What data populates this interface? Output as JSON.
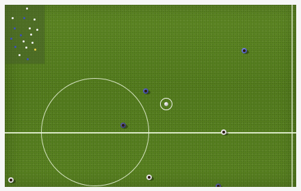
{
  "scene": {
    "type": "top-down football match",
    "pitch_color": "#58811f",
    "line_color": "#ebf5dc"
  },
  "minimap": {
    "background": "#465f28",
    "dots": [
      {
        "team": "white"
      },
      {
        "team": "white"
      },
      {
        "team": "blue"
      },
      {
        "team": "white"
      },
      {
        "team": "blue"
      },
      {
        "team": "white"
      },
      {
        "team": "white"
      },
      {
        "team": "blue"
      },
      {
        "team": "white"
      },
      {
        "team": "blue"
      },
      {
        "team": "white"
      },
      {
        "team": "white"
      },
      {
        "team": "blue"
      },
      {
        "team": "white"
      },
      {
        "team": "yellow"
      },
      {
        "team": "white"
      },
      {
        "team": "blue"
      }
    ]
  },
  "players": [
    {
      "team": "blue"
    },
    {
      "team": "blue"
    },
    {
      "team": "dark"
    },
    {
      "team": "white"
    },
    {
      "team": "white"
    },
    {
      "team": "white"
    },
    {
      "team": "dark"
    }
  ],
  "ball": {
    "selected": true
  },
  "footer_label": ""
}
